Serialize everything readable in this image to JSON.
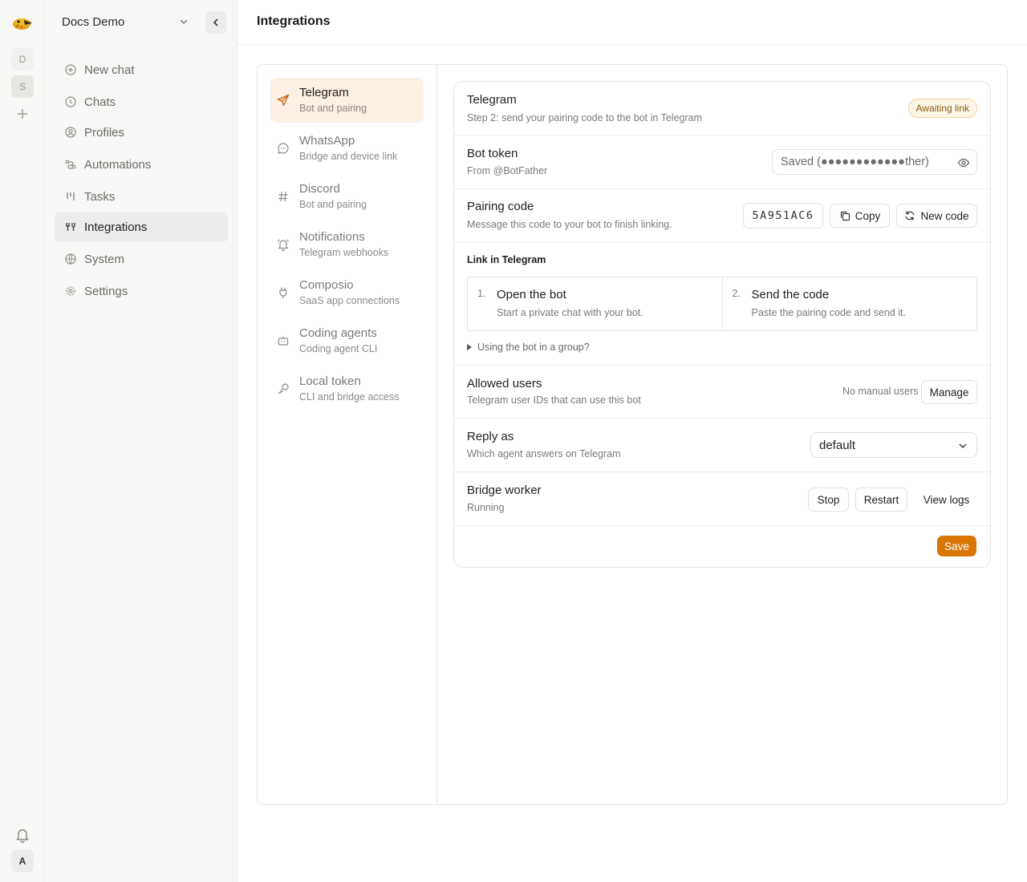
{
  "rail": {
    "workspaces": [
      "D",
      "S"
    ],
    "avatar": "A"
  },
  "sidebar": {
    "workspace_name": "Docs Demo",
    "items": [
      {
        "label": "New chat",
        "icon": "plus-circle-icon"
      },
      {
        "label": "Chats",
        "icon": "clock-icon"
      },
      {
        "label": "Profiles",
        "icon": "user-circle-icon"
      },
      {
        "label": "Automations",
        "icon": "route-icon"
      },
      {
        "label": "Tasks",
        "icon": "kanban-icon"
      },
      {
        "label": "Integrations",
        "icon": "integrations-icon"
      },
      {
        "label": "System",
        "icon": "globe-icon"
      },
      {
        "label": "Settings",
        "icon": "gear-icon"
      }
    ],
    "active": "Integrations"
  },
  "header": {
    "title": "Integrations"
  },
  "subnav": {
    "items": [
      {
        "title": "Telegram",
        "subtitle": "Bot and pairing",
        "icon": "send-icon"
      },
      {
        "title": "WhatsApp",
        "subtitle": "Bridge and device link",
        "icon": "message-circle-icon"
      },
      {
        "title": "Discord",
        "subtitle": "Bot and pairing",
        "icon": "hash-icon"
      },
      {
        "title": "Notifications",
        "subtitle": "Telegram webhooks",
        "icon": "bell-icon"
      },
      {
        "title": "Composio",
        "subtitle": "SaaS app connections",
        "icon": "plug-icon"
      },
      {
        "title": "Coding agents",
        "subtitle": "Coding agent CLI",
        "icon": "robot-icon"
      },
      {
        "title": "Local token",
        "subtitle": "CLI and bridge access",
        "icon": "key-icon"
      }
    ],
    "active": "Telegram"
  },
  "card": {
    "header": {
      "title": "Telegram",
      "subtitle": "Step 2: send your pairing code to the bot in Telegram",
      "badge": "Awaiting link"
    },
    "bot_token": {
      "title": "Bot token",
      "subtitle": "From @BotFather",
      "value": "Saved (●●●●●●●●●●●●ther)"
    },
    "pairing": {
      "title": "Pairing code",
      "subtitle": "Message this code to your bot to finish linking.",
      "code": "5A951AC6",
      "copy_label": "Copy",
      "new_code_label": "New code"
    },
    "link": {
      "title": "Link in Telegram",
      "steps": [
        {
          "num": "1.",
          "title": "Open the bot",
          "subtitle": "Start a private chat with your bot."
        },
        {
          "num": "2.",
          "title": "Send the code",
          "subtitle": "Paste the pairing code and send it."
        }
      ],
      "group_hint": "Using the bot in a group?"
    },
    "allowed": {
      "title": "Allowed users",
      "subtitle": "Telegram user IDs that can use this bot",
      "status": "No manual users",
      "manage_label": "Manage"
    },
    "reply": {
      "title": "Reply as",
      "subtitle": "Which agent answers on Telegram",
      "selected": "default"
    },
    "bridge": {
      "title": "Bridge worker",
      "status": "Running",
      "stop_label": "Stop",
      "restart_label": "Restart",
      "logs_label": "View logs"
    },
    "save_label": "Save"
  },
  "colors": {
    "accent": "#d97706",
    "active_bg": "#fcefe3",
    "badge_bg": "#fdf7e8"
  }
}
